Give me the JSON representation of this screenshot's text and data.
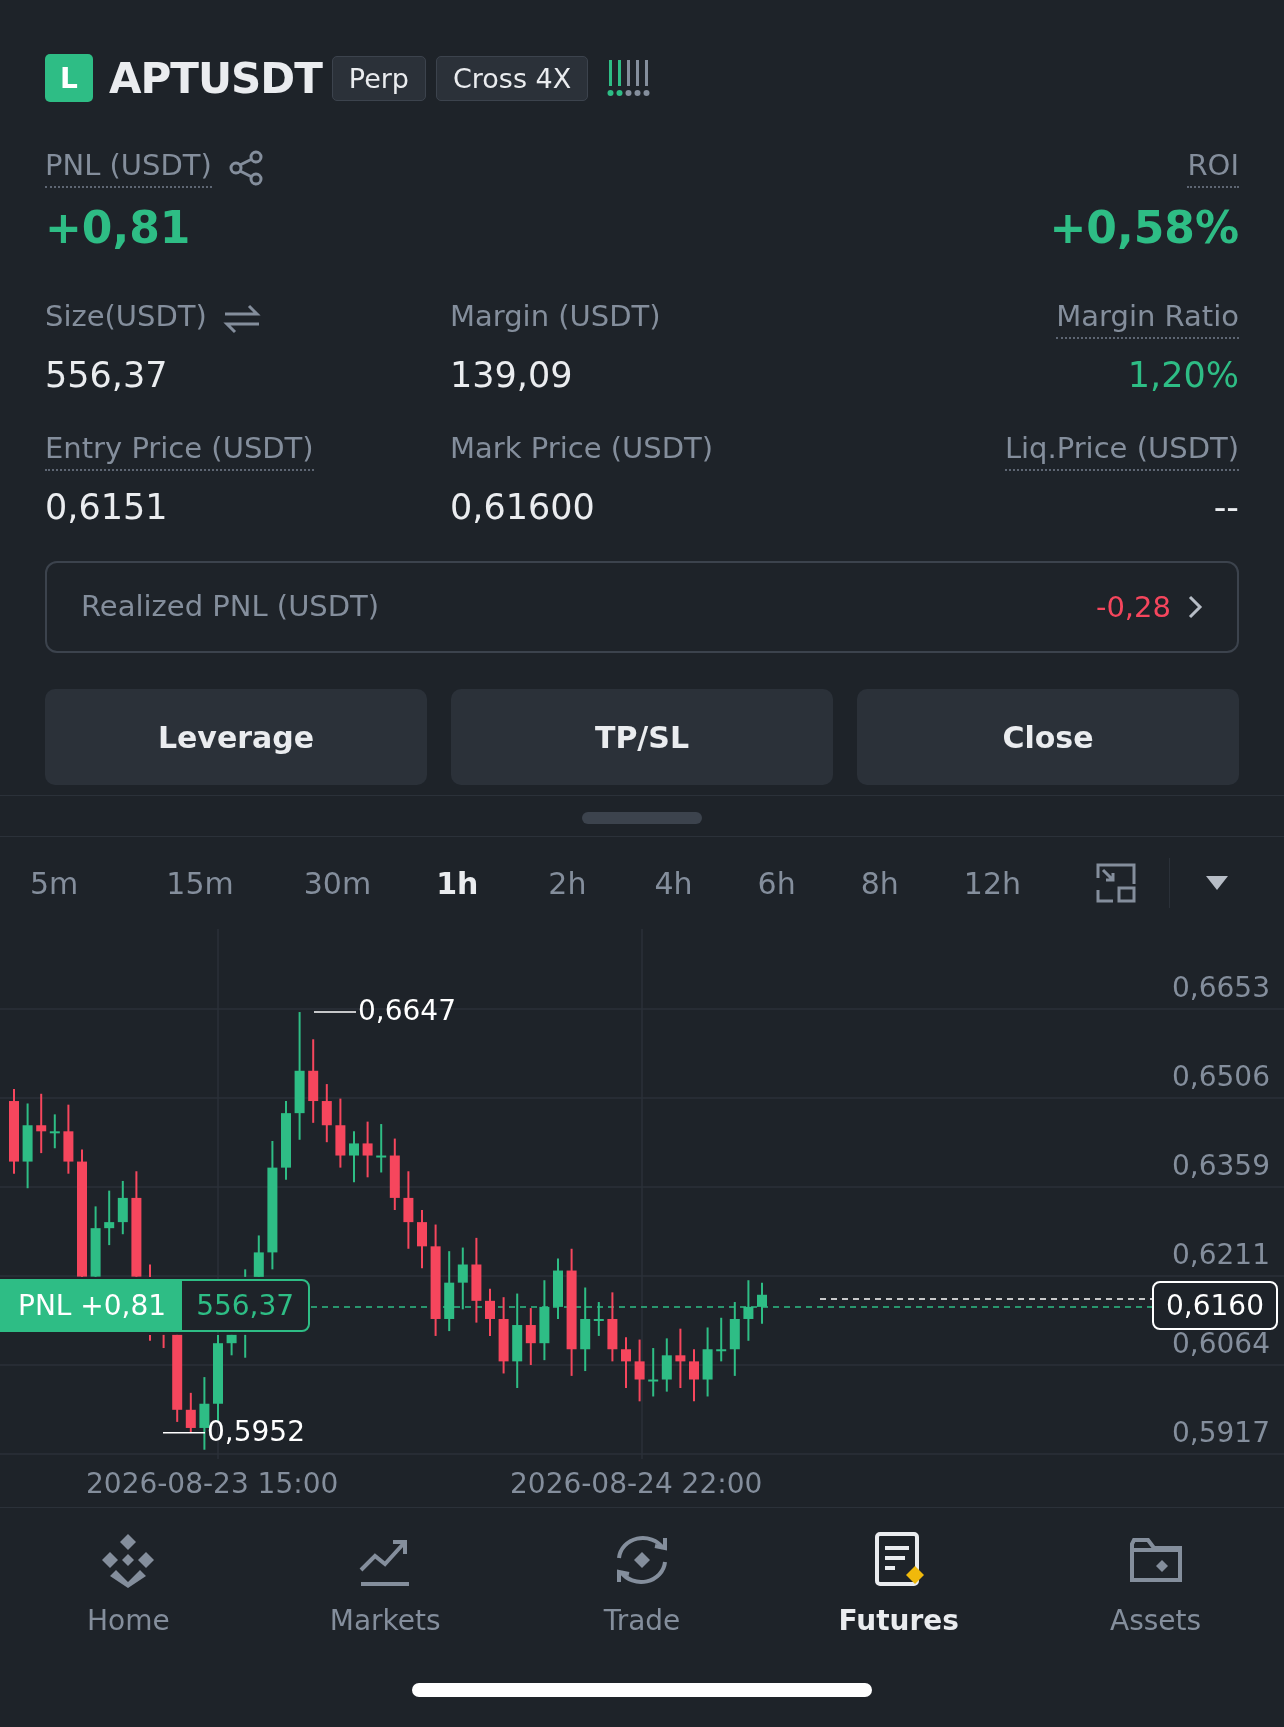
{
  "position": {
    "side": "L",
    "symbol": "APTUSDT",
    "tags": [
      "Perp",
      "Cross 4X"
    ]
  },
  "pnl": {
    "label": "PNL (USDT)",
    "value": "+0,81"
  },
  "roi": {
    "label": "ROI",
    "value": "+0,58%"
  },
  "stats": [
    {
      "label": "Size(USDT)",
      "value": "556,37",
      "kind": "swap",
      "dotted": false,
      "positive": false
    },
    {
      "label": "Margin (USDT)",
      "value": "139,09",
      "kind": "plain",
      "dotted": false,
      "positive": false
    },
    {
      "label": "Margin Ratio",
      "value": "1,20%",
      "kind": "plain",
      "dotted": true,
      "positive": true
    },
    {
      "label": "Entry Price (USDT)",
      "value": "0,6151",
      "kind": "plain",
      "dotted": true,
      "positive": false
    },
    {
      "label": "Mark Price (USDT)",
      "value": "0,61600",
      "kind": "plain",
      "dotted": false,
      "positive": false
    },
    {
      "label": "Liq.Price (USDT)",
      "value": "--",
      "kind": "plain",
      "dotted": true,
      "positive": false
    }
  ],
  "realized": {
    "label": "Realized PNL (USDT)",
    "value": "-0,28"
  },
  "buttons": [
    "Leverage",
    "TP/SL",
    "Close"
  ],
  "intervals": [
    {
      "label": "5m",
      "selected": false
    },
    {
      "label": "15m",
      "selected": false
    },
    {
      "label": "30m",
      "selected": false
    },
    {
      "label": "1h",
      "selected": true
    },
    {
      "label": "2h",
      "selected": false
    },
    {
      "label": "4h",
      "selected": false
    },
    {
      "label": "6h",
      "selected": false
    },
    {
      "label": "8h",
      "selected": false
    },
    {
      "label": "12h",
      "selected": false
    }
  ],
  "chart": {
    "price_ticks": [
      "0,6653",
      "0,6506",
      "0,6359",
      "0,6211",
      "0,6064",
      "0,5917"
    ],
    "high_label": "0,6647",
    "low_label": "0,5952",
    "current_price": "0,6160",
    "pnl_tag": {
      "label": "PNL +0,81",
      "size": "556,37"
    },
    "date_ticks": [
      "2026-08-23 15:00",
      "2026-08-24 22:00"
    ]
  },
  "nav": [
    {
      "label": "Home",
      "selected": false
    },
    {
      "label": "Markets",
      "selected": false
    },
    {
      "label": "Trade",
      "selected": false
    },
    {
      "label": "Futures",
      "selected": true
    },
    {
      "label": "Assets",
      "selected": false
    }
  ]
}
